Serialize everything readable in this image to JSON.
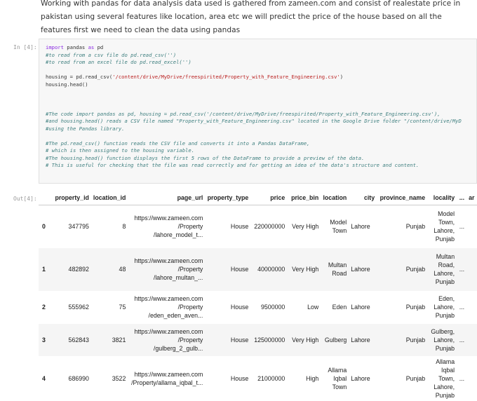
{
  "markdown": "Working with pandas for data analysis data used is gathered from zameen.com and consist of realestate price in pakistan using several features like location, area etc we will predict the price of the house based on all the features first we need to clean the data using pandas",
  "in_prompt": "In [4]:",
  "out_prompt": "Out[4]:",
  "code": {
    "import_kw": "import",
    "import_rest": " pandas ",
    "as_kw": "as",
    "import_alias": " pd",
    "c1": "#to read from a csv file do pd.read_csv('')",
    "c2": "#to read from an excel file do pd.read_excel('')",
    "l4a": "housing = pd.read_csv(",
    "l4s": "'/content/drive/MyDrive/freespirited/Property_with_Feature_Engineering.csv'",
    "l4b": ")",
    "l5": "housing.head()",
    "c3": "#The code import pandas as pd, housing = pd.read_csv('/content/drive/MyDrive/freespirited/Property_with_Feature_Engineering.csv'),",
    "c4": "#and housing.head() reads a CSV file named \"Property_with_Feature_Engineering.csv\" located in the Google Drive folder \"/content/drive/MyD",
    "c5": "#using the Pandas library.",
    "c6": "#The pd.read_csv() function reads the CSV file and converts it into a Pandas DataFrame,",
    "c7": "# which is then assigned to the housing variable.",
    "c8": "#The housing.head() function displays the first 5 rows of the DataFrame to provide a preview of the data.",
    "c9": "# This is useful for checking that the file was read correctly and for getting an idea of the data's structure and content."
  },
  "table": {
    "columns": [
      "",
      "property_id",
      "location_id",
      "page_url",
      "property_type",
      "price",
      "price_bin",
      "location",
      "city",
      "province_name",
      "locality",
      "...",
      "ar"
    ],
    "rows": [
      {
        "idx": "0",
        "property_id": "347795",
        "location_id": "8",
        "url1": "https://www.zameen.com",
        "url2": "/Property",
        "url3": "/lahore_model_t...",
        "property_type": "House",
        "price": "220000000",
        "price_bin": "Very High",
        "loc1": "Model",
        "loc2": "Town",
        "city": "Lahore",
        "province_name": "Punjab",
        "lc1": "Model",
        "lc2": "Town,",
        "lc3": "Lahore,",
        "lc4": "Punjab",
        "ellipsis": "..."
      },
      {
        "idx": "1",
        "property_id": "482892",
        "location_id": "48",
        "url1": "https://www.zameen.com",
        "url2": "/Property",
        "url3": "/lahore_multan_...",
        "property_type": "House",
        "price": "40000000",
        "price_bin": "Very High",
        "loc1": "Multan",
        "loc2": "Road",
        "city": "Lahore",
        "province_name": "Punjab",
        "lc1": "Multan",
        "lc2": "Road,",
        "lc3": "Lahore,",
        "lc4": "Punjab",
        "ellipsis": "..."
      },
      {
        "idx": "2",
        "property_id": "555962",
        "location_id": "75",
        "url1": "https://www.zameen.com",
        "url2": "/Property",
        "url3": "/eden_eden_aven...",
        "property_type": "House",
        "price": "9500000",
        "price_bin": "Low",
        "loc1": "Eden",
        "loc2": "",
        "city": "Lahore",
        "province_name": "Punjab",
        "lc1": "Eden,",
        "lc2": "Lahore,",
        "lc3": "Punjab",
        "lc4": "",
        "ellipsis": "..."
      },
      {
        "idx": "3",
        "property_id": "562843",
        "location_id": "3821",
        "url1": "https://www.zameen.com",
        "url2": "/Property",
        "url3": "/gulberg_2_gulb...",
        "property_type": "House",
        "price": "125000000",
        "price_bin": "Very High",
        "loc1": "Gulberg",
        "loc2": "",
        "city": "Lahore",
        "province_name": "Punjab",
        "lc1": "Gulberg,",
        "lc2": "Lahore,",
        "lc3": "Punjab",
        "lc4": "",
        "ellipsis": "..."
      },
      {
        "idx": "4",
        "property_id": "686990",
        "location_id": "3522",
        "url1": "https://www.zameen.com",
        "url2": "/Property/allama_iqbal_t...",
        "url3": "",
        "property_type": "House",
        "price": "21000000",
        "price_bin": "High",
        "loc1": "Allama",
        "loc2": "Iqbal",
        "loc3": "Town",
        "city": "Lahore",
        "province_name": "Punjab",
        "lc1": "Allama",
        "lc2": "Iqbal",
        "lc3": "Town,",
        "lc4": "Lahore,",
        "lc5": "Punjab",
        "ellipsis": "..."
      }
    ]
  }
}
